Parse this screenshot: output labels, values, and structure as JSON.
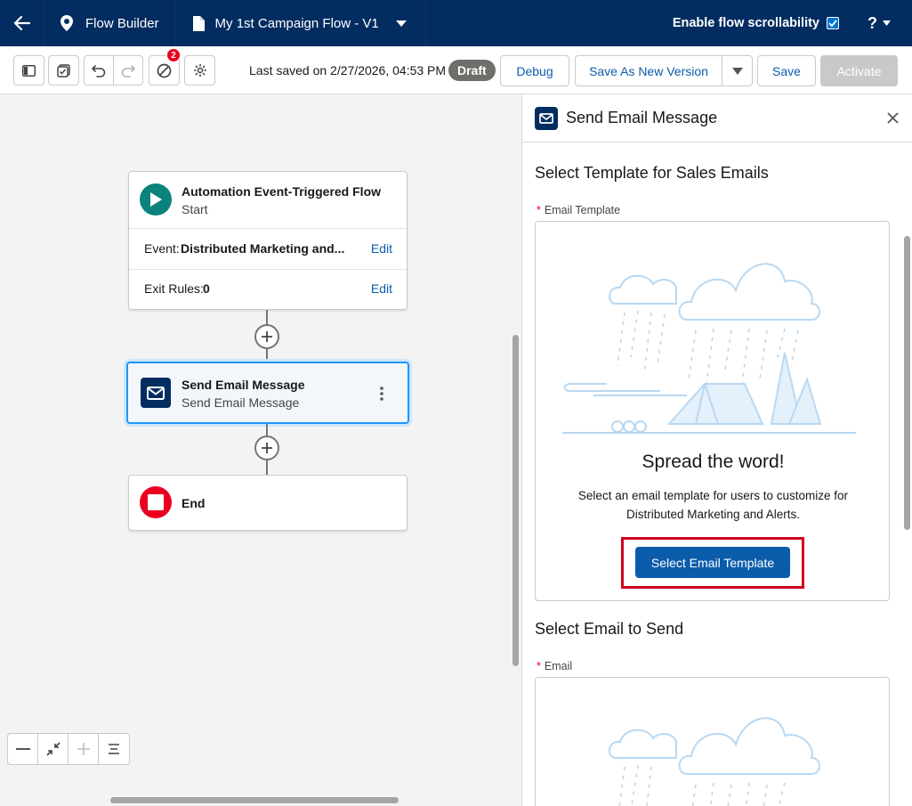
{
  "topbar": {
    "app_name": "Flow Builder",
    "flow_name": "My 1st Campaign Flow - V1",
    "scroll_toggle_label": "Enable flow scrollability",
    "help_label": "?"
  },
  "toolbar": {
    "badge_count": "2",
    "last_saved": "Last saved on 2/27/2026, 04:53 PM",
    "status_pill": "Draft",
    "debug_label": "Debug",
    "save_as_new_label": "Save As New Version",
    "save_label": "Save",
    "activate_label": "Activate"
  },
  "canvas": {
    "start_node": {
      "title": "Automation Event-Triggered Flow",
      "subtitle": "Start",
      "event_label": "Event:",
      "event_value": "Distributed Marketing and...",
      "exit_label": "Exit Rules:",
      "exit_value": "0",
      "edit_label": "Edit"
    },
    "email_node": {
      "title": "Send Email Message",
      "subtitle": "Send Email Message"
    },
    "end_node": {
      "title": "End"
    }
  },
  "panel": {
    "title": "Send Email Message",
    "section1_title": "Select Template for Sales Emails",
    "email_template_label": "Email Template",
    "empty_heading": "Spread the word!",
    "empty_desc": "Select an email template for users to customize for Distributed Marketing and Alerts.",
    "select_template_button": "Select Email Template",
    "section2_title": "Select Email to Send",
    "email_label": "Email"
  },
  "colors": {
    "nav_bg": "#032d60",
    "brand_blue": "#0b5cab",
    "start_green": "#0b827c",
    "end_red": "#ea001e",
    "highlight_red": "#d0021b",
    "illustration_blue": "#b8d8f2"
  }
}
